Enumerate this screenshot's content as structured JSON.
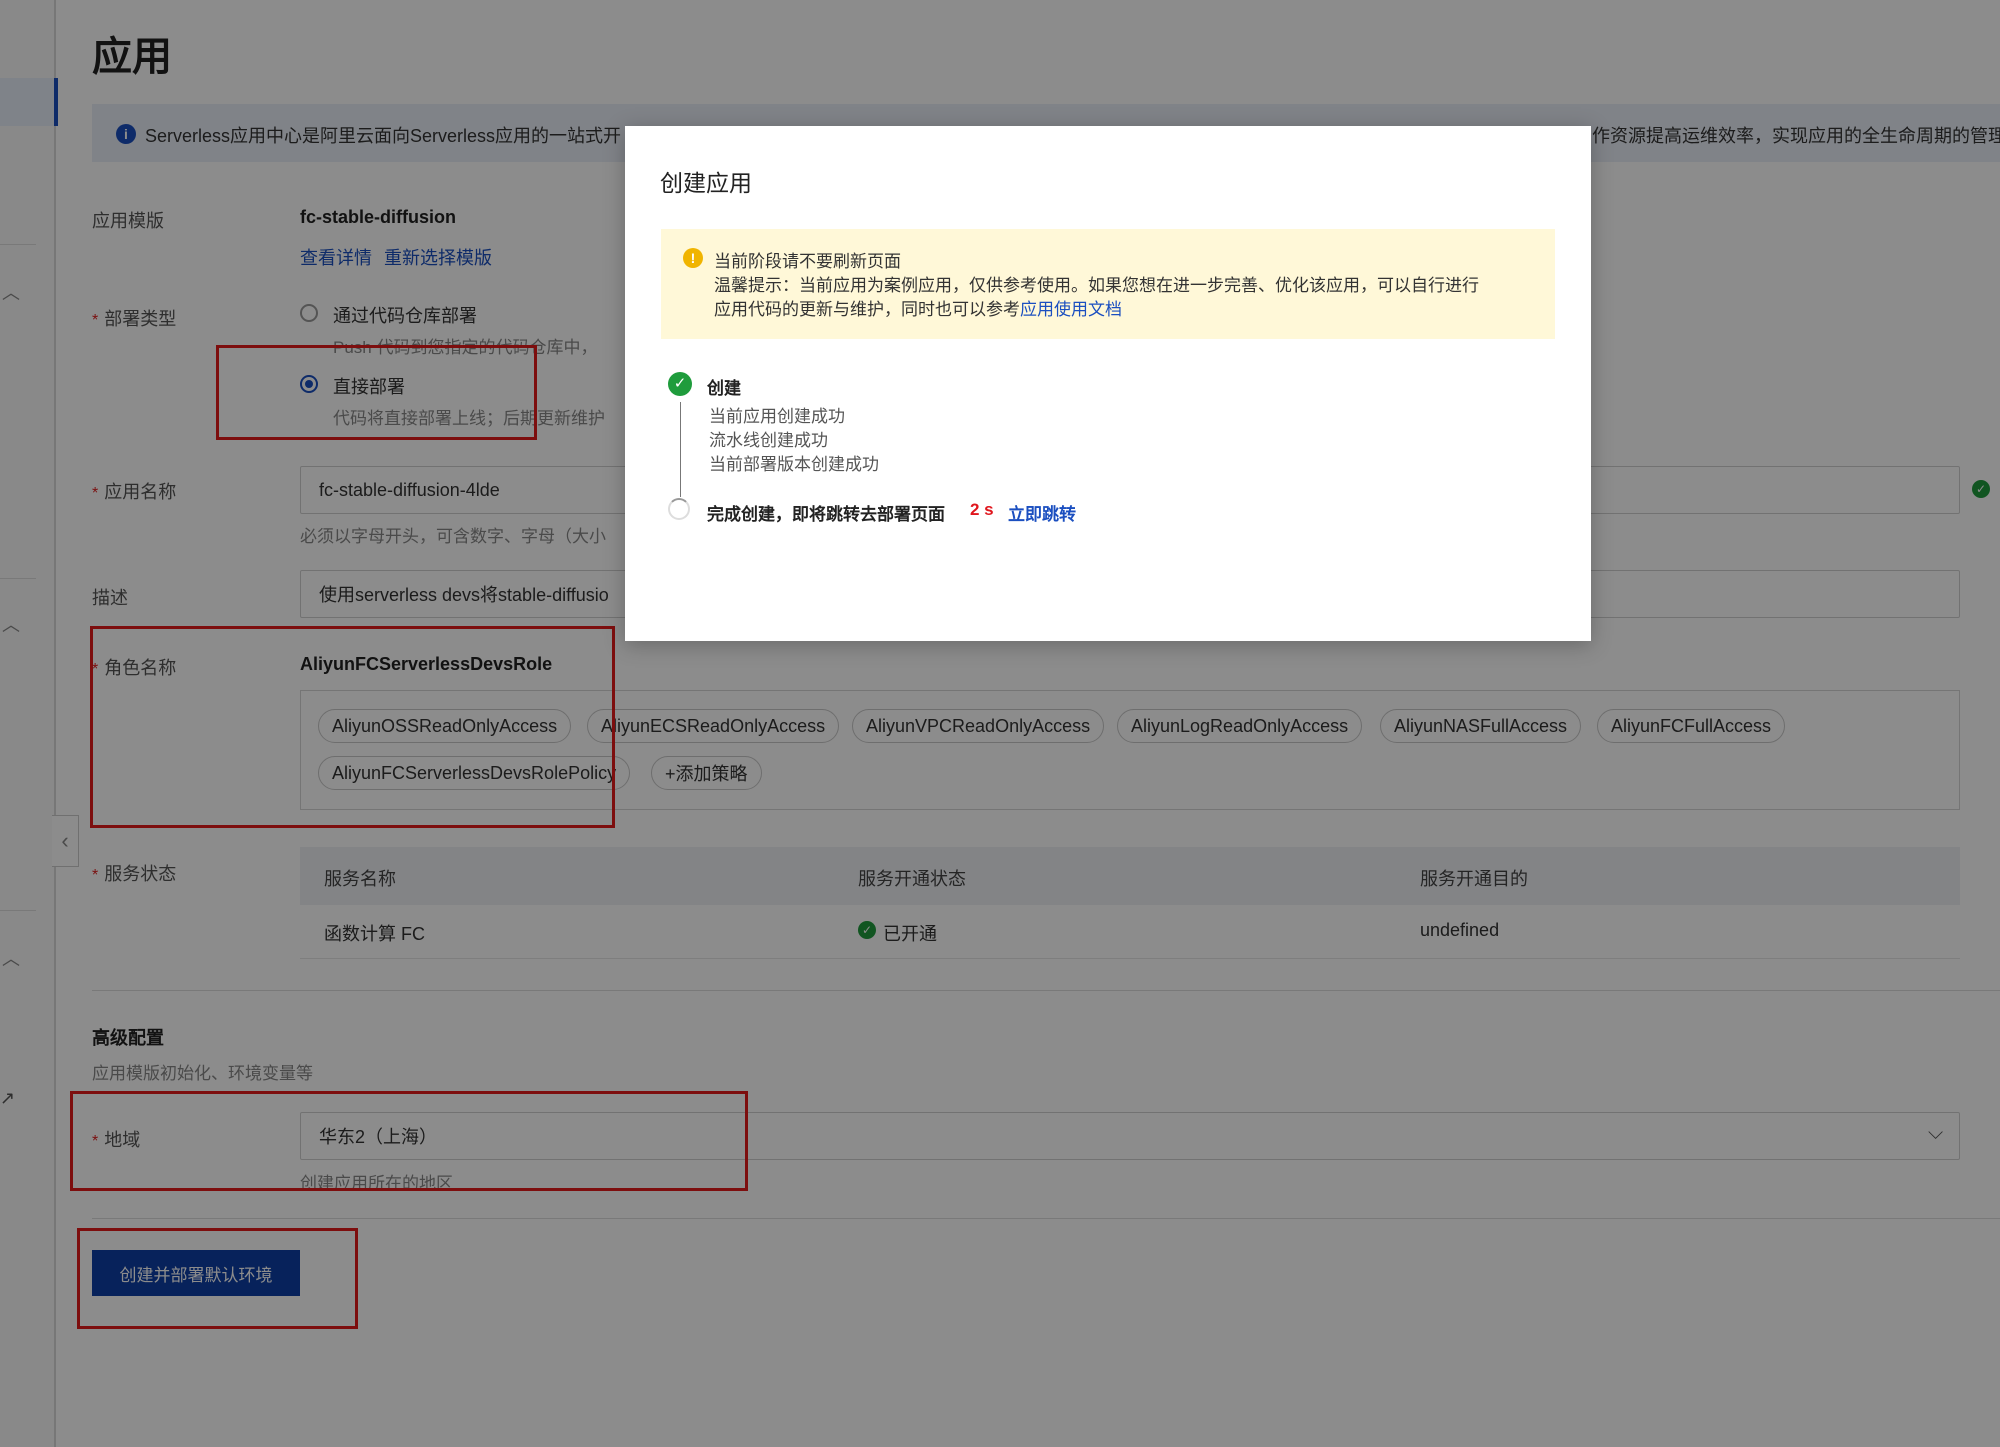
{
  "page": {
    "title": "应用",
    "info": "Serverless应用中心是阿里云面向Serverless应用的一站式开",
    "info_right": "作资源提高运维效率，实现应用的全生命周期的管理"
  },
  "form": {
    "template_label": "应用模版",
    "template_value": "fc-stable-diffusion",
    "view_details": "查看详情",
    "reselect_template": "重新选择模版",
    "deploy_type_label": "部署类型",
    "deploy_option_repo": "通过代码仓库部署",
    "deploy_option_repo_hint": "Push 代码到您指定的代码仓库中，",
    "deploy_option_direct": "直接部署",
    "deploy_option_direct_hint": "代码将直接部署上线；后期更新维护",
    "app_name_label": "应用名称",
    "app_name_value": "fc-stable-diffusion-4lde",
    "app_name_hint": "必须以字母开头，可含数字、字母（大小",
    "description_label": "描述",
    "description_value": "使用serverless devs将stable-diffusio",
    "role_label": "角色名称",
    "role_value": "AliyunFCServerlessDevsRole",
    "policies": [
      "AliyunOSSReadOnlyAccess",
      "AliyunECSReadOnlyAccess",
      "AliyunVPCReadOnlyAccess",
      "AliyunLogReadOnlyAccess",
      "AliyunNASFullAccess",
      "AliyunFCFullAccess",
      "AliyunFCServerlessDevsRolePolicy"
    ],
    "add_policy": "+添加策略",
    "service_status_label": "服务状态",
    "service_table": {
      "headers": [
        "服务名称",
        "服务开通状态",
        "服务开通目的"
      ],
      "rows": [
        [
          "函数计算 FC",
          "已开通",
          "undefined"
        ]
      ]
    },
    "advanced_title": "高级配置",
    "advanced_hint": "应用模版初始化、环境变量等",
    "region_label": "地域",
    "region_value": "华东2（上海）",
    "region_hint": "创建应用所在的地区",
    "submit_label": "创建并部署默认环境"
  },
  "modal": {
    "title": "创建应用",
    "warning_title": "当前阶段请不要刷新页面",
    "warning_line1": "温馨提示：当前应用为案例应用，仅供参考使用。如果您想在进一步完善、优化该应用，可以自行进行",
    "warning_line2_prefix": "应用代码的更新与维护，同时也可以参考",
    "warning_link": "应用使用文档",
    "step1_title": "创建",
    "step1_items": [
      "当前应用创建成功",
      "流水线创建成功",
      "当前部署版本创建成功"
    ],
    "step2_text": "完成创建，即将跳转去部署页面",
    "countdown": "2 s",
    "jump_now": "立即跳转"
  },
  "colors": {
    "primary": "#0d3fa6",
    "link": "#1b4fc0",
    "success": "#1f9c3c",
    "warning": "#f0b400",
    "countdown": "#e0161d",
    "highlight_box": "#e31b1b"
  }
}
